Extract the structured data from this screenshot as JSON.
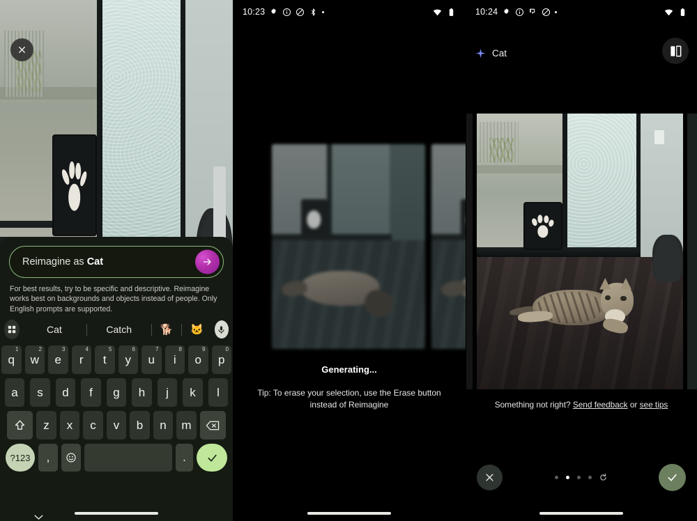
{
  "panels": {
    "left": {
      "statusbar": null,
      "close_button_icon": "close-icon",
      "prompt": {
        "prefix": "Reimagine as ",
        "value": "Cat",
        "full_text": "Reimagine as Cat",
        "send_icon": "arrow-right-icon",
        "border_color": "#8ab87a",
        "send_button_color": "#b02fa8"
      },
      "hint": "For best results, try to be specific and descriptive. Reimagine works best on backgrounds and objects instead of people. Only English prompts are supported.",
      "suggestions": {
        "grid_icon": "apps-grid-icon",
        "words": [
          "Cat",
          "Catch"
        ],
        "emojis": [
          "🐕",
          "🐱"
        ],
        "mic_icon": "microphone-icon"
      },
      "keyboard": {
        "row1": [
          {
            "k": "q",
            "n": "1"
          },
          {
            "k": "w",
            "n": "2"
          },
          {
            "k": "e",
            "n": "3"
          },
          {
            "k": "r",
            "n": "4"
          },
          {
            "k": "t",
            "n": "5"
          },
          {
            "k": "y",
            "n": "6"
          },
          {
            "k": "u",
            "n": "7"
          },
          {
            "k": "i",
            "n": "8"
          },
          {
            "k": "o",
            "n": "9"
          },
          {
            "k": "p",
            "n": "0"
          }
        ],
        "row2": [
          "a",
          "s",
          "d",
          "f",
          "g",
          "h",
          "j",
          "k",
          "l"
        ],
        "row3": [
          "z",
          "x",
          "c",
          "v",
          "b",
          "n",
          "m"
        ],
        "shift_icon": "shift-up-icon",
        "backspace_icon": "backspace-icon",
        "symbols_key": "?123",
        "comma_key": ",",
        "emoji_key_icon": "emoji-smiley-icon",
        "space_key": "",
        "period_key": ".",
        "enter_icon": "check-icon"
      },
      "navbar": {
        "chevron_icon": "chevron-down-icon",
        "home_pill": "home-indicator"
      }
    },
    "middle": {
      "statusbar": {
        "time": "10:23",
        "icons": [
          "gear-icon",
          "info-circle-icon",
          "dnd-slash-icon",
          "bluetooth-icon",
          "dot-icon"
        ],
        "right_icons": [
          "wifi-icon",
          "battery-icon"
        ]
      },
      "generating_title": "Generating...",
      "tip": "Tip: To erase your selection, use the Erase button instead of Reimagine"
    },
    "right": {
      "statusbar": {
        "time": "10:24",
        "icons": [
          "gear-icon",
          "info-circle-icon",
          "paint-icon",
          "dnd-slash-icon",
          "dot-icon"
        ],
        "right_icons": [
          "wifi-icon",
          "battery-icon"
        ]
      },
      "chip": {
        "sparkle_icon": "sparkle-icon",
        "sparkle_color": "#7c8cf8",
        "label": "Cat"
      },
      "compare_button_icon": "compare-before-after-icon",
      "feedback": {
        "prefix": "Something not right? ",
        "link1": "Send feedback",
        "middle": " or ",
        "link2": "see tips"
      },
      "actions": {
        "discard_icon": "close-icon",
        "accept_icon": "check-icon",
        "accept_color": "#6c7f5e",
        "pager": {
          "count": 4,
          "active_index": 1,
          "refresh_icon": "refresh-icon"
        }
      },
      "navbar": {
        "home_pill": "home-indicator"
      }
    }
  }
}
